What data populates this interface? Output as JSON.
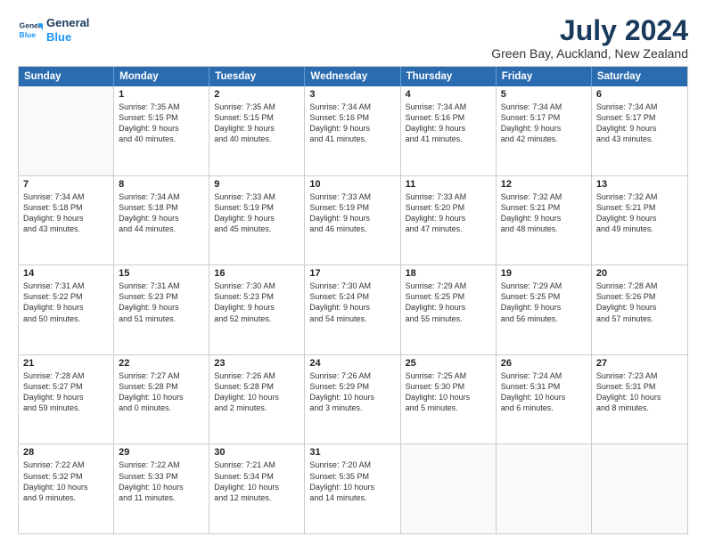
{
  "logo": {
    "line1": "General",
    "line2": "Blue"
  },
  "title": "July 2024",
  "location": "Green Bay, Auckland, New Zealand",
  "header_days": [
    "Sunday",
    "Monday",
    "Tuesday",
    "Wednesday",
    "Thursday",
    "Friday",
    "Saturday"
  ],
  "weeks": [
    [
      {
        "day": "",
        "lines": [],
        "empty": true
      },
      {
        "day": "1",
        "lines": [
          "Sunrise: 7:35 AM",
          "Sunset: 5:15 PM",
          "Daylight: 9 hours",
          "and 40 minutes."
        ]
      },
      {
        "day": "2",
        "lines": [
          "Sunrise: 7:35 AM",
          "Sunset: 5:15 PM",
          "Daylight: 9 hours",
          "and 40 minutes."
        ]
      },
      {
        "day": "3",
        "lines": [
          "Sunrise: 7:34 AM",
          "Sunset: 5:16 PM",
          "Daylight: 9 hours",
          "and 41 minutes."
        ]
      },
      {
        "day": "4",
        "lines": [
          "Sunrise: 7:34 AM",
          "Sunset: 5:16 PM",
          "Daylight: 9 hours",
          "and 41 minutes."
        ]
      },
      {
        "day": "5",
        "lines": [
          "Sunrise: 7:34 AM",
          "Sunset: 5:17 PM",
          "Daylight: 9 hours",
          "and 42 minutes."
        ]
      },
      {
        "day": "6",
        "lines": [
          "Sunrise: 7:34 AM",
          "Sunset: 5:17 PM",
          "Daylight: 9 hours",
          "and 43 minutes."
        ]
      }
    ],
    [
      {
        "day": "7",
        "lines": [
          "Sunrise: 7:34 AM",
          "Sunset: 5:18 PM",
          "Daylight: 9 hours",
          "and 43 minutes."
        ]
      },
      {
        "day": "8",
        "lines": [
          "Sunrise: 7:34 AM",
          "Sunset: 5:18 PM",
          "Daylight: 9 hours",
          "and 44 minutes."
        ]
      },
      {
        "day": "9",
        "lines": [
          "Sunrise: 7:33 AM",
          "Sunset: 5:19 PM",
          "Daylight: 9 hours",
          "and 45 minutes."
        ]
      },
      {
        "day": "10",
        "lines": [
          "Sunrise: 7:33 AM",
          "Sunset: 5:19 PM",
          "Daylight: 9 hours",
          "and 46 minutes."
        ]
      },
      {
        "day": "11",
        "lines": [
          "Sunrise: 7:33 AM",
          "Sunset: 5:20 PM",
          "Daylight: 9 hours",
          "and 47 minutes."
        ]
      },
      {
        "day": "12",
        "lines": [
          "Sunrise: 7:32 AM",
          "Sunset: 5:21 PM",
          "Daylight: 9 hours",
          "and 48 minutes."
        ]
      },
      {
        "day": "13",
        "lines": [
          "Sunrise: 7:32 AM",
          "Sunset: 5:21 PM",
          "Daylight: 9 hours",
          "and 49 minutes."
        ]
      }
    ],
    [
      {
        "day": "14",
        "lines": [
          "Sunrise: 7:31 AM",
          "Sunset: 5:22 PM",
          "Daylight: 9 hours",
          "and 50 minutes."
        ]
      },
      {
        "day": "15",
        "lines": [
          "Sunrise: 7:31 AM",
          "Sunset: 5:23 PM",
          "Daylight: 9 hours",
          "and 51 minutes."
        ]
      },
      {
        "day": "16",
        "lines": [
          "Sunrise: 7:30 AM",
          "Sunset: 5:23 PM",
          "Daylight: 9 hours",
          "and 52 minutes."
        ]
      },
      {
        "day": "17",
        "lines": [
          "Sunrise: 7:30 AM",
          "Sunset: 5:24 PM",
          "Daylight: 9 hours",
          "and 54 minutes."
        ]
      },
      {
        "day": "18",
        "lines": [
          "Sunrise: 7:29 AM",
          "Sunset: 5:25 PM",
          "Daylight: 9 hours",
          "and 55 minutes."
        ]
      },
      {
        "day": "19",
        "lines": [
          "Sunrise: 7:29 AM",
          "Sunset: 5:25 PM",
          "Daylight: 9 hours",
          "and 56 minutes."
        ]
      },
      {
        "day": "20",
        "lines": [
          "Sunrise: 7:28 AM",
          "Sunset: 5:26 PM",
          "Daylight: 9 hours",
          "and 57 minutes."
        ]
      }
    ],
    [
      {
        "day": "21",
        "lines": [
          "Sunrise: 7:28 AM",
          "Sunset: 5:27 PM",
          "Daylight: 9 hours",
          "and 59 minutes."
        ]
      },
      {
        "day": "22",
        "lines": [
          "Sunrise: 7:27 AM",
          "Sunset: 5:28 PM",
          "Daylight: 10 hours",
          "and 0 minutes."
        ]
      },
      {
        "day": "23",
        "lines": [
          "Sunrise: 7:26 AM",
          "Sunset: 5:28 PM",
          "Daylight: 10 hours",
          "and 2 minutes."
        ]
      },
      {
        "day": "24",
        "lines": [
          "Sunrise: 7:26 AM",
          "Sunset: 5:29 PM",
          "Daylight: 10 hours",
          "and 3 minutes."
        ]
      },
      {
        "day": "25",
        "lines": [
          "Sunrise: 7:25 AM",
          "Sunset: 5:30 PM",
          "Daylight: 10 hours",
          "and 5 minutes."
        ]
      },
      {
        "day": "26",
        "lines": [
          "Sunrise: 7:24 AM",
          "Sunset: 5:31 PM",
          "Daylight: 10 hours",
          "and 6 minutes."
        ]
      },
      {
        "day": "27",
        "lines": [
          "Sunrise: 7:23 AM",
          "Sunset: 5:31 PM",
          "Daylight: 10 hours",
          "and 8 minutes."
        ]
      }
    ],
    [
      {
        "day": "28",
        "lines": [
          "Sunrise: 7:22 AM",
          "Sunset: 5:32 PM",
          "Daylight: 10 hours",
          "and 9 minutes."
        ]
      },
      {
        "day": "29",
        "lines": [
          "Sunrise: 7:22 AM",
          "Sunset: 5:33 PM",
          "Daylight: 10 hours",
          "and 11 minutes."
        ]
      },
      {
        "day": "30",
        "lines": [
          "Sunrise: 7:21 AM",
          "Sunset: 5:34 PM",
          "Daylight: 10 hours",
          "and 12 minutes."
        ]
      },
      {
        "day": "31",
        "lines": [
          "Sunrise: 7:20 AM",
          "Sunset: 5:35 PM",
          "Daylight: 10 hours",
          "and 14 minutes."
        ]
      },
      {
        "day": "",
        "lines": [],
        "empty": true
      },
      {
        "day": "",
        "lines": [],
        "empty": true
      },
      {
        "day": "",
        "lines": [],
        "empty": true
      }
    ]
  ]
}
